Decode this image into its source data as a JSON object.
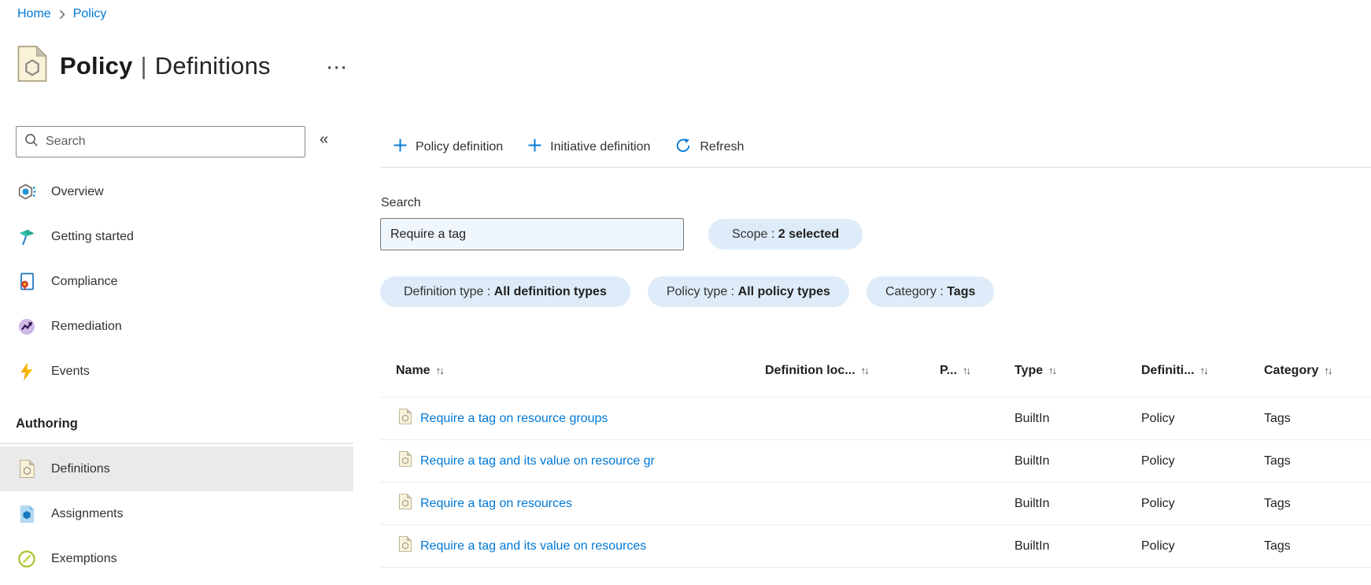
{
  "breadcrumb": {
    "items": [
      {
        "label": "Home"
      },
      {
        "label": "Policy"
      }
    ]
  },
  "header": {
    "title_primary": "Policy",
    "title_separator": "|",
    "title_secondary": "Definitions",
    "more_glyph": "···"
  },
  "sidebar": {
    "search_placeholder": "Search",
    "collapse_glyph": "«",
    "items": [
      {
        "label": "Overview",
        "icon": "overview-icon"
      },
      {
        "label": "Getting started",
        "icon": "getting-started-icon"
      },
      {
        "label": "Compliance",
        "icon": "compliance-icon"
      },
      {
        "label": "Remediation",
        "icon": "remediation-icon"
      },
      {
        "label": "Events",
        "icon": "events-icon"
      }
    ],
    "section_label": "Authoring",
    "authoring_items": [
      {
        "label": "Definitions",
        "icon": "policy-definition-icon",
        "selected": true
      },
      {
        "label": "Assignments",
        "icon": "assignments-icon",
        "selected": false
      },
      {
        "label": "Exemptions",
        "icon": "exemptions-icon",
        "selected": false
      }
    ]
  },
  "toolbar": {
    "items": [
      {
        "label": "Policy definition",
        "icon": "plus-icon"
      },
      {
        "label": "Initiative definition",
        "icon": "plus-icon"
      },
      {
        "label": "Refresh",
        "icon": "refresh-icon"
      }
    ]
  },
  "filters": {
    "search_label": "Search",
    "search_value": "Require a tag",
    "separator": " : ",
    "scope": {
      "label": "Scope",
      "value": "2 selected"
    },
    "pills": [
      {
        "label": "Definition type",
        "value": "All definition types"
      },
      {
        "label": "Policy type",
        "value": "All policy types"
      },
      {
        "label": "Category",
        "value": "Tags"
      }
    ]
  },
  "table": {
    "sort_glyph": "↑↓",
    "columns": [
      "Name",
      "Definition loc...",
      "P...",
      "Type",
      "Definiti...",
      "Category"
    ],
    "rows": [
      {
        "name": "Require a tag on resource groups",
        "definition_location": "",
        "p": "",
        "type": "BuiltIn",
        "definition_type": "Policy",
        "category": "Tags"
      },
      {
        "name": "Require a tag and its value on resource gr",
        "definition_location": "",
        "p": "",
        "type": "BuiltIn",
        "definition_type": "Policy",
        "category": "Tags"
      },
      {
        "name": "Require a tag on resources",
        "definition_location": "",
        "p": "",
        "type": "BuiltIn",
        "definition_type": "Policy",
        "category": "Tags"
      },
      {
        "name": "Require a tag and its value on resources",
        "definition_location": "",
        "p": "",
        "type": "BuiltIn",
        "definition_type": "Policy",
        "category": "Tags"
      }
    ]
  },
  "colors": {
    "accent_blue": "#0078d4",
    "link_blue": "#0078d4",
    "pill_background": "#deecf9",
    "search_field_background": "#eff6fc",
    "selected_item_background": "#eaeaea",
    "row_divider": "#edebe9",
    "policy_icon_fill": "#f9f2d9",
    "events_bolt_orange": "#f59b00",
    "remediation_purple": "#cfb9e4",
    "exemptions_green": "#a3c52d"
  }
}
